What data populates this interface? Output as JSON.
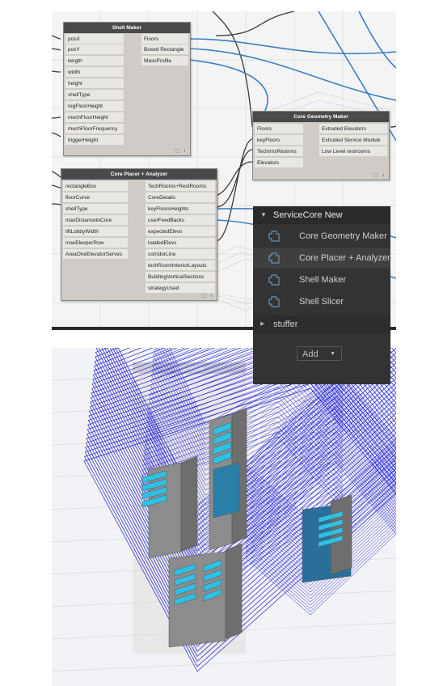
{
  "nodes": {
    "shell_maker": {
      "title": "Shell Maker",
      "inputs": [
        "posX",
        "posY",
        "length",
        "width",
        "height",
        "shellType",
        "regFloorHeight",
        "mechFloorHeight",
        "mechFloorFrequency",
        "triggerHeight"
      ],
      "outputs": [
        "Floors",
        "Boxed Rectangle",
        "MassProfile"
      ]
    },
    "core_geometry_maker": {
      "title": "Core Geometry Maker",
      "inputs": [
        "Floors",
        "keyFloors",
        "TechrmsRestrms",
        "Elevators"
      ],
      "outputs": [
        "Extruded Elevators",
        "Extruded Service Module",
        "Low Level restrooms"
      ]
    },
    "core_placer_analyzer": {
      "title": "Core Placer + Analyzer",
      "inputs": [
        "rectangleBox",
        "floorCurve",
        "shellType",
        "maxDistancetoCore",
        "liftLobbyWidth",
        "maxElevperRow",
        "AreaOneElevatorServes"
      ],
      "outputs": [
        "TechRooms+RestRooms",
        "CoreDetails",
        "keyFloorsHeights",
        "userFeedBacks",
        "expectedElevs",
        "loadedElevs",
        "corridorLine",
        "techRoomInteriorLayouts",
        "BuildingVerticalSections",
        "strategyUsed"
      ]
    },
    "footer_glyph": "⬚ ı"
  },
  "library": {
    "category": "ServiceCore New",
    "items": [
      "Core Geometry Maker",
      "Core Placer + Analyzer",
      "Shell Maker",
      "Shell Slicer"
    ],
    "highlighted_index": 1,
    "subcategory": "stuffer",
    "add_label": "Add",
    "icon": "custom-node-icon"
  },
  "background_node": {
    "title": "Shell Maker"
  },
  "colors": {
    "node_header": "#4a4a4a",
    "node_body": "#cfcbc6",
    "wire_dark": "#333333",
    "wire_blue": "#3f7fbf",
    "library_bg": "#333333",
    "shell_lines": "#1f1fd6",
    "core_gray": "#8c8c8c",
    "elevator_cyan": "#2ec0e6"
  }
}
